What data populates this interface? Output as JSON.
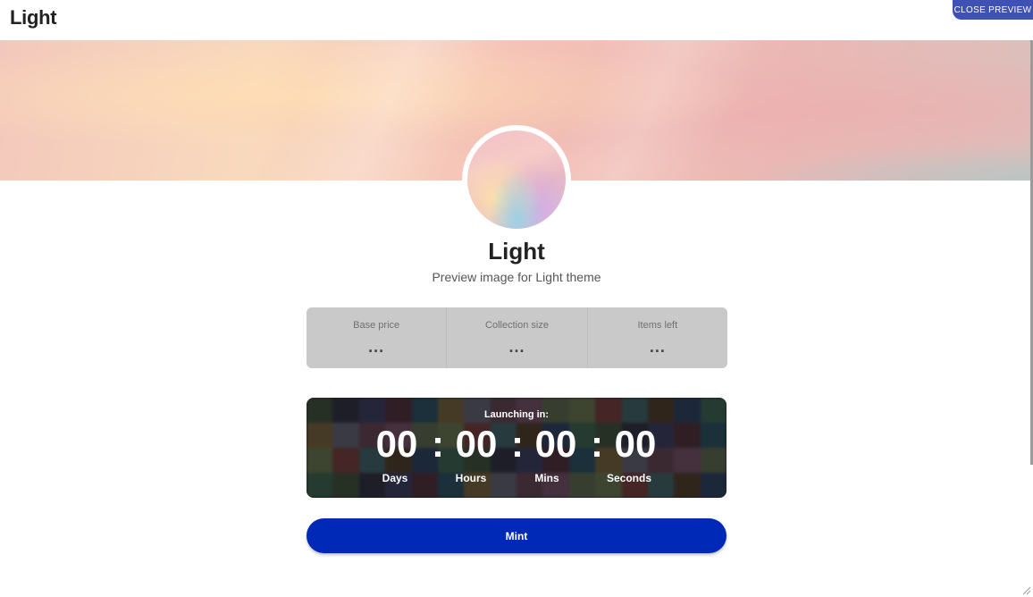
{
  "header": {
    "title": "Light",
    "close_preview_label": "CLOSE PREVIEW"
  },
  "profile": {
    "name": "Light",
    "description": "Preview image for Light theme"
  },
  "stats": [
    {
      "label": "Base price",
      "value": "..."
    },
    {
      "label": "Collection size",
      "value": "..."
    },
    {
      "label": "Items left",
      "value": "..."
    }
  ],
  "countdown": {
    "label": "Launching in:",
    "days": "00",
    "hours": "00",
    "mins": "00",
    "seconds": "00",
    "separator": ":",
    "units": {
      "days": "Days",
      "hours": "Hours",
      "mins": "Mins",
      "seconds": "Seconds"
    }
  },
  "mint": {
    "label": "Mint"
  },
  "colors": {
    "accent_button": "#0129b8",
    "close_preview": "#3f51b5",
    "stats_bg": "#c9c9c9"
  },
  "icons": [
    "resize-handle-icon"
  ]
}
